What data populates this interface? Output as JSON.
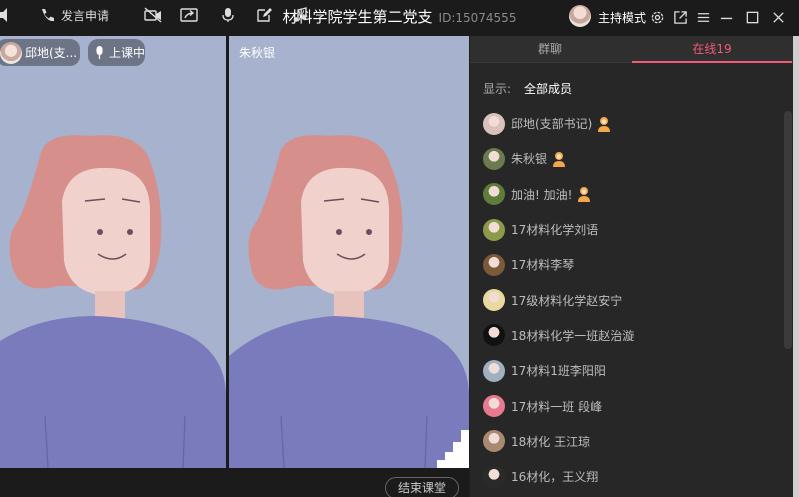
{
  "window": {
    "title": "材料学院学生第二党支",
    "room_id": "ID:15074555",
    "host_mode_label": "主持模式"
  },
  "video": {
    "pane1": {
      "user_name": "邱地(支...",
      "status": "上课中"
    },
    "pane2": {
      "user_name": "朱秋银"
    }
  },
  "toolbar": {
    "speak_request_label": "发言申请",
    "end_class_label": "结束课堂"
  },
  "side_panel": {
    "tabs": [
      {
        "label": "群聊",
        "active": false
      },
      {
        "label": "在线19",
        "active": true
      }
    ],
    "filter_label": "显示:",
    "filter_value": "全部成员",
    "members": [
      {
        "name": "邱地(支部书记)",
        "host": true,
        "avatar_color": "#d9c2bb"
      },
      {
        "name": "朱秋银",
        "host": true,
        "avatar_color": "#6b7b4f"
      },
      {
        "name": "加油!  加油!",
        "host": true,
        "avatar_color": "#5e7d3a"
      },
      {
        "name": "17材料化学刘语",
        "host": false,
        "avatar_color": "#8d9a4a"
      },
      {
        "name": "17材料李琴",
        "host": false,
        "avatar_color": "#7a5a3a"
      },
      {
        "name": "17级材料化学赵安宁",
        "host": false,
        "avatar_color": "#e8d9a0"
      },
      {
        "name": "18材料化学一班赵治漩",
        "host": false,
        "avatar_color": "#111111"
      },
      {
        "name": "17材料1班李阳阳",
        "host": false,
        "avatar_color": "#9fb0c0"
      },
      {
        "name": "17材料一班 段峰",
        "host": false,
        "avatar_color": "#e77a8e"
      },
      {
        "name": "18材化 王江琼",
        "host": false,
        "avatar_color": "#a88a70"
      },
      {
        "name": "16材化，王义翔",
        "host": false,
        "avatar_color": "#2a2a2a"
      }
    ]
  },
  "colors": {
    "accent": "#f05a78",
    "video_bg": "#a6b2ce",
    "panel_bg": "#272727"
  }
}
